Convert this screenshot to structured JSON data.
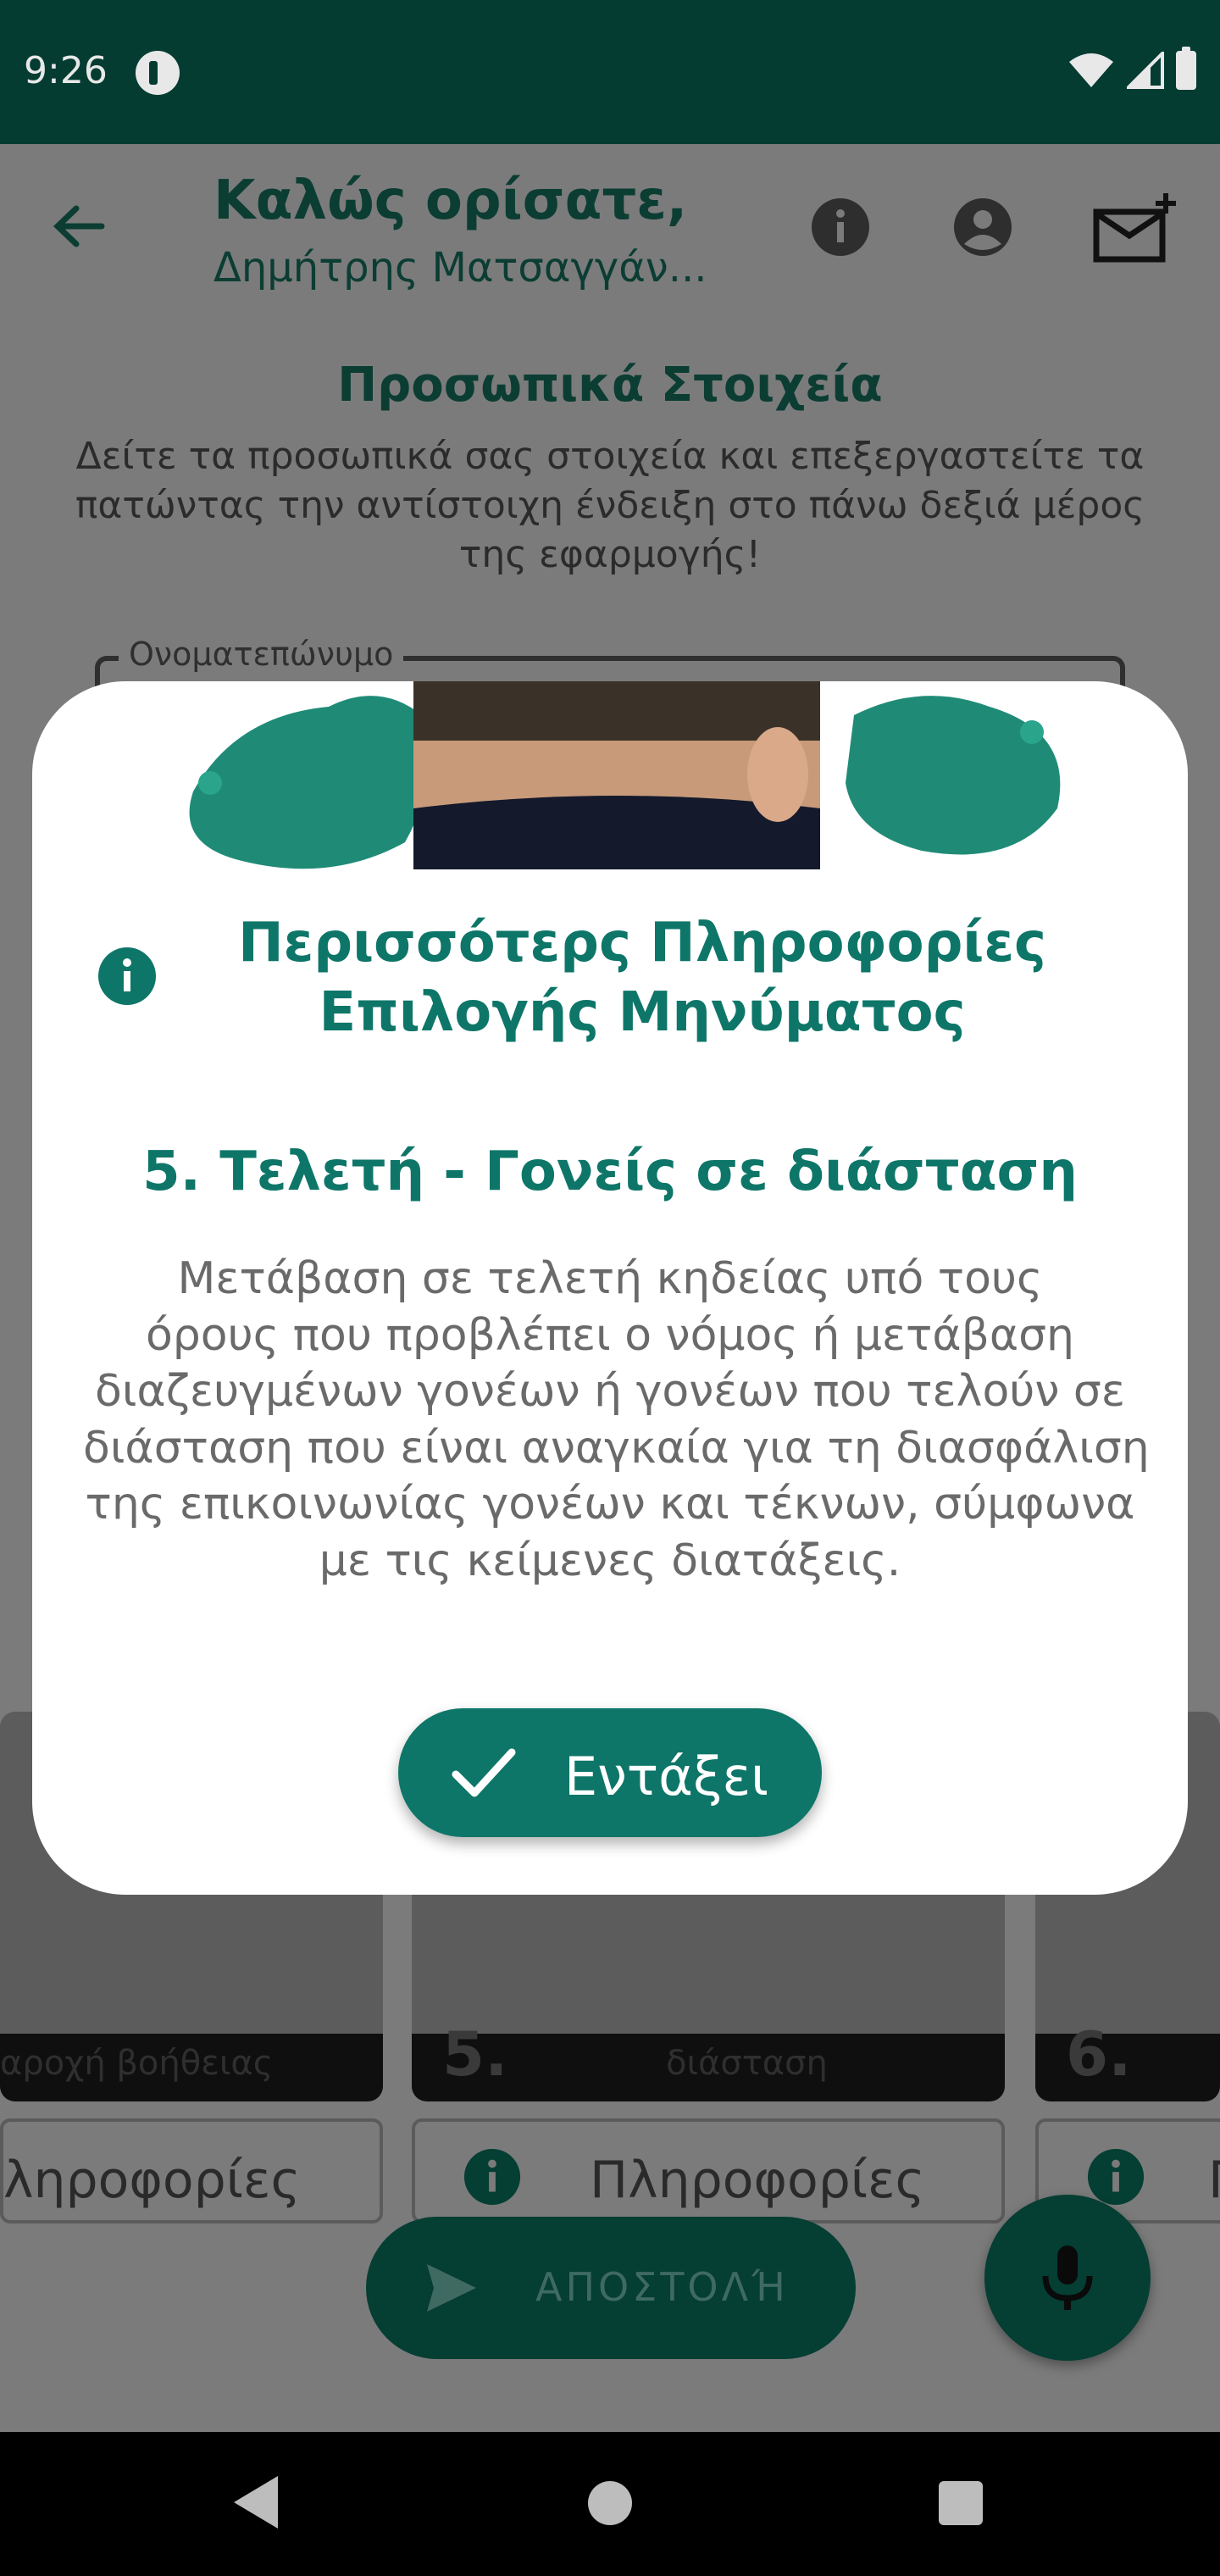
{
  "status_bar": {
    "time": "9:26"
  },
  "header": {
    "welcome_title": "Καλώς ορίσατε,",
    "user_name": "Δημήτρης Ματσαγγάν..."
  },
  "profile": {
    "section_title": "Προσωπικά Στοιχεία",
    "description_lines": [
      "Δείτε τα προσωπικά σας στοιχεία και επεξεργαστείτε τα",
      "πατώντας την αντίστοιχη ένδειξη στο πάνω δεξιά μέρος",
      "της εφαρμογής!"
    ],
    "fullname_label": "Ονοματεπώνυμο"
  },
  "cards": [
    {
      "number": "",
      "caption": "αροχή βοήθειας",
      "info_label": "ληροφορίες"
    },
    {
      "number": "5.",
      "caption": "διάσταση",
      "info_label": "Πληροφορίες"
    },
    {
      "number": "6.",
      "caption": "",
      "info_label": "Π"
    }
  ],
  "send_button": {
    "label": "ΑΠΟΣΤΟΛΉ"
  },
  "dialog": {
    "title_lines": [
      "Περισσότερς Πληροφορίες",
      "Επιλογής Μηνύματος"
    ],
    "subtitle": "5. Τελετή - Γονείς σε διάσταση",
    "body_lines": [
      "Μετάβαση σε τελετή κηδείας υπό τους",
      "όρους που προβλέπει ο νόμος ή μετάβαση",
      "διαζευγμένων γονέων ή γονέων που τελούν σε",
      "διάσταση που είναι αναγκαία για τη διασφάλιση",
      "της επικοινωνίας γονέων και τέκνων, σύμφωνα",
      "με τις κείμενες διατάξεις."
    ],
    "accept_label": "Εντάξει"
  },
  "colors": {
    "accent": "#0e7668",
    "status_bar": "#043c32",
    "scrim_background": "#7b7b7b"
  },
  "icons": [
    "back-arrow-icon",
    "info-icon",
    "account-icon",
    "mail-plus-icon",
    "send-icon",
    "mic-icon",
    "check-icon"
  ]
}
